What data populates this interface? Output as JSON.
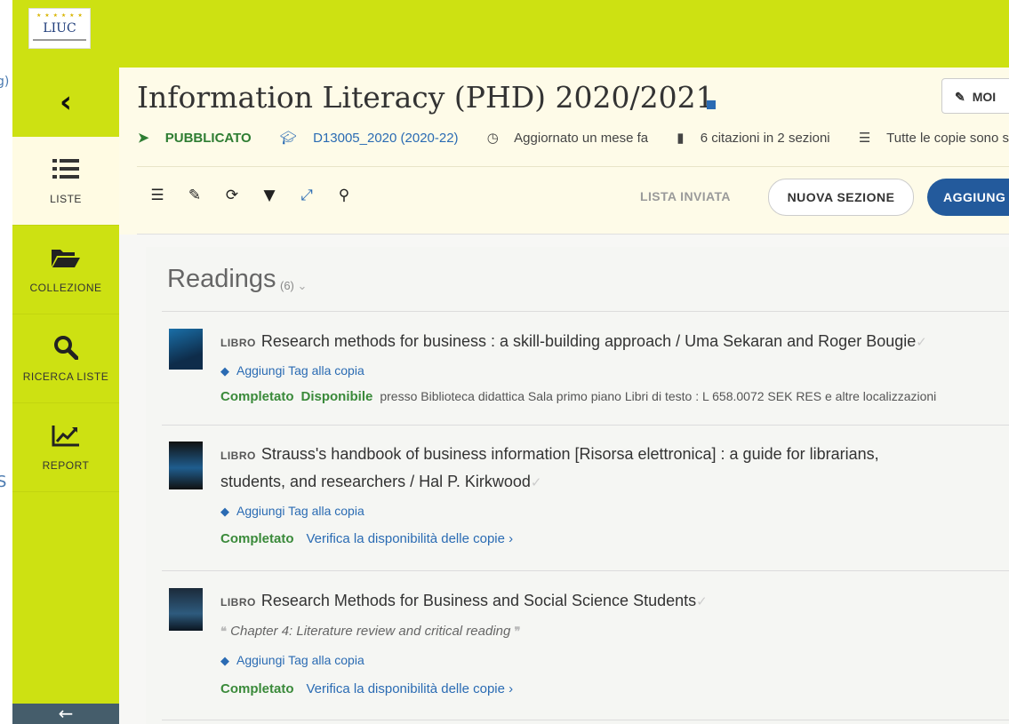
{
  "crop_left": {
    "fragments": [
      "g)",
      "S"
    ]
  },
  "logo": {
    "name": "LIUC",
    "stars": "★ ★ ★ ★ ★ ★"
  },
  "sidebar": {
    "back_icon": "chevron-left-icon",
    "items": [
      {
        "label": "LISTE",
        "icon": "list-icon",
        "glyph": "☰",
        "active": true
      },
      {
        "label": "COLLEZIONE",
        "icon": "folder-open-icon",
        "glyph": "▰",
        "active": false
      },
      {
        "label": "RICERCA LISTE",
        "icon": "search-icon",
        "glyph": "⚲",
        "active": false
      },
      {
        "label": "REPORT",
        "icon": "line-chart-icon",
        "glyph": "↗",
        "active": false
      }
    ],
    "bottom_arrow": "←"
  },
  "header": {
    "title": "Information Literacy (PHD) 2020/2021",
    "modify_label": "MOI",
    "meta": {
      "status": "PUBBLICATO",
      "course": "D13005_2020 (2020-22)",
      "updated": "Aggiornato un mese fa",
      "citations": "6 citazioni in 2 sezioni",
      "copies": "Tutte le copie sono sta"
    }
  },
  "toolbar": {
    "icons": [
      "list-icon",
      "edit-icon",
      "refresh-icon",
      "filter-icon",
      "expand-icon",
      "search-icon"
    ],
    "lista_inviata": "LISTA INVIATA",
    "nuova_sezione": "NUOVA SEZIONE",
    "aggiungi": "AGGIUNG"
  },
  "section": {
    "title": "Readings",
    "count": "(6)",
    "items": [
      {
        "type": "LIBRO",
        "title_line1": "Research methods for business : a skill-building approach / Uma Sekaran and Roger Bougie",
        "title_line2": "",
        "tag_link": "Aggiungi Tag alla copia",
        "status": "Completato",
        "availability": "Disponibile",
        "location": "presso Biblioteca didattica Sala primo piano Libri di testo : L 658.0072 SEK RES e altre localizzazioni"
      },
      {
        "type": "LIBRO",
        "title_line1": "Strauss's handbook of business information [Risorsa elettronica] : a guide for librarians,",
        "title_line2": "students, and researchers / Hal P. Kirkwood",
        "tag_link": "Aggiungi Tag alla copia",
        "status": "Completato",
        "verify": "Verifica la disponibilità delle copie ›"
      },
      {
        "type": "LIBRO",
        "title_line1": "Research Methods for Business and Social Science Students",
        "note": "Chapter 4: Literature review and critical reading",
        "tag_link": "Aggiungi Tag alla copia",
        "status": "Completato",
        "verify": "Verifica la disponibilità delle copie ›"
      }
    ]
  },
  "colors": {
    "lime": "#cde112",
    "header_bg": "#fefbe8",
    "primary_blue": "#235a9c",
    "green": "#3a8a3a"
  }
}
